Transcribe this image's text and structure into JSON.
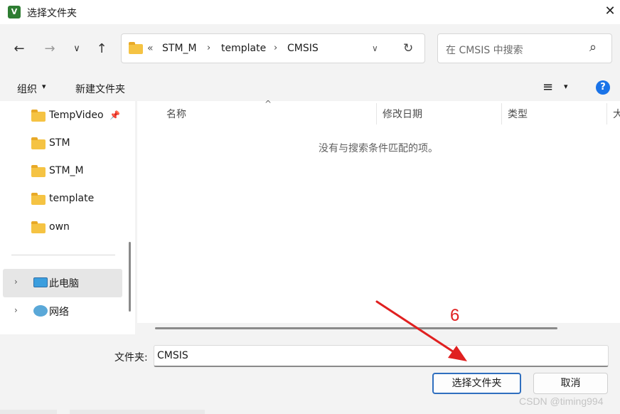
{
  "window": {
    "title": "选择文件夹",
    "close_glyph": "✕"
  },
  "nav": {
    "back_glyph": "←",
    "forward_glyph": "→",
    "recent_glyph": "∨",
    "up_glyph": "↑"
  },
  "address": {
    "overflow": "«",
    "crumbs": [
      "STM_M",
      "template",
      "CMSIS"
    ],
    "separator": "›",
    "dropdown_glyph": "∨",
    "refresh_glyph": "↻"
  },
  "search": {
    "placeholder": "在 CMSIS 中搜索",
    "icon_glyph": "⌕"
  },
  "toolbar": {
    "organize_label": "组织",
    "organize_arrow": "▾",
    "new_folder_label": "新建文件夹",
    "view_glyph": "≡",
    "view_arrow": "▾",
    "help_glyph": "?"
  },
  "sidebar": {
    "items": [
      {
        "label": "TempVideo",
        "pinned": true
      },
      {
        "label": "STM"
      },
      {
        "label": "STM_M"
      },
      {
        "label": "template"
      },
      {
        "label": "own"
      }
    ],
    "pin_glyph": "📌",
    "expand_glyph": "›",
    "this_pc_label": "此电脑",
    "network_label": "网络"
  },
  "columns": {
    "name": "名称",
    "modified": "修改日期",
    "type": "类型",
    "size": "大",
    "sort_glyph": "^"
  },
  "empty_message": "没有与搜索条件匹配的项。",
  "footer": {
    "folder_label": "文件夹:",
    "folder_value": "CMSIS",
    "select_button": "选择文件夹",
    "cancel_button": "取消"
  },
  "annotation": {
    "step_number": "6",
    "color": "#e02020"
  },
  "watermark": "CSDN @timing994",
  "colors": {
    "folder": "#f5c343",
    "accent": "#1a73e8",
    "primary_border": "#2f6fbf"
  }
}
